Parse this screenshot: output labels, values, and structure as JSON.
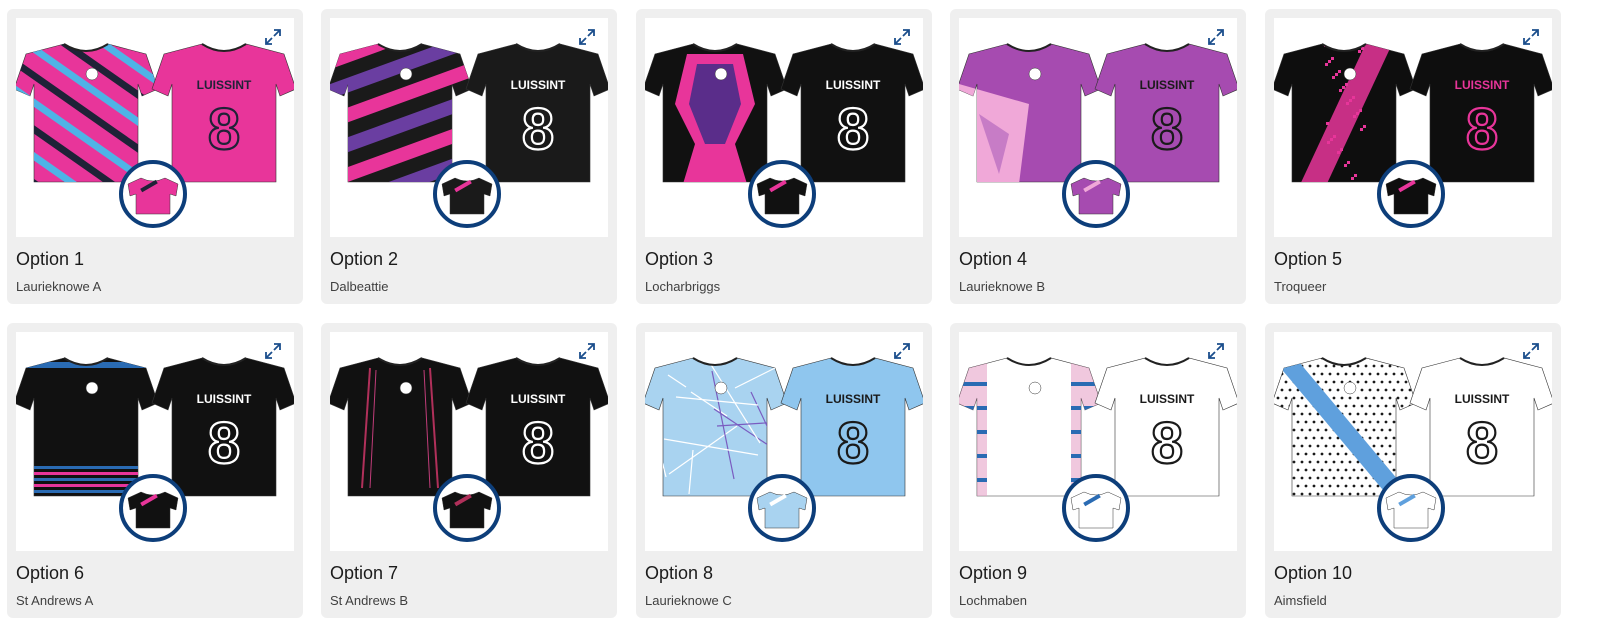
{
  "sponsor_text": "LUISSINT",
  "shirt_number": "8",
  "options": [
    {
      "title": "Option 1",
      "subtitle": "Laurieknowe A",
      "primary": "#e8359a",
      "secondary": "#1f2237",
      "accent": "#4fb3e6",
      "pattern": "stripes-diag",
      "back": "#e8359a",
      "num_color": "#1f2237",
      "thumb_ring": "#0d3e7a"
    },
    {
      "title": "Option 2",
      "subtitle": "Dalbeattie",
      "primary": "#1a1a1a",
      "secondary": "#e8359a",
      "accent": "#6a3ea1",
      "pattern": "bands-diag",
      "back": "#1a1a1a",
      "num_color": "#ffffff",
      "thumb_ring": "#0d3e7a"
    },
    {
      "title": "Option 3",
      "subtitle": "Locharbriggs",
      "primary": "#111111",
      "secondary": "#e8359a",
      "accent": "#5a2d8a",
      "pattern": "chevron",
      "back": "#111111",
      "num_color": "#ffffff",
      "thumb_ring": "#0d3e7a"
    },
    {
      "title": "Option 4",
      "subtitle": "Laurieknowe B",
      "primary": "#a64bb0",
      "secondary": "#f0a8d8",
      "accent": "#c77cc6",
      "pattern": "star",
      "back": "#a64bb0",
      "num_color": "#1a1a1a",
      "thumb_ring": "#0d3e7a"
    },
    {
      "title": "Option 5",
      "subtitle": "Troqueer",
      "primary": "#0e0e0e",
      "secondary": "#e8359a",
      "accent": "#e8359a",
      "pattern": "sash",
      "back": "#0e0e0e",
      "num_color": "#e8359a",
      "thumb_ring": "#0d3e7a"
    },
    {
      "title": "Option 6",
      "subtitle": "St Andrews A",
      "primary": "#111111",
      "secondary": "#e8359a",
      "accent": "#2a6bb3",
      "pattern": "hem-stripes",
      "back": "#111111",
      "num_color": "#ffffff",
      "thumb_ring": "#0d3e7a"
    },
    {
      "title": "Option 7",
      "subtitle": "St Andrews B",
      "primary": "#111111",
      "secondary": "#b0305a",
      "accent": "#c23d7a",
      "pattern": "pinstripe",
      "back": "#111111",
      "num_color": "#ffffff",
      "thumb_ring": "#0d3e7a"
    },
    {
      "title": "Option 8",
      "subtitle": "Laurieknowe C",
      "primary": "#a9d3f0",
      "secondary": "#ffffff",
      "accent": "#7a5cc0",
      "pattern": "geo",
      "back": "#8fc6ee",
      "num_color": "#1a1a1a",
      "thumb_ring": "#0d3e7a"
    },
    {
      "title": "Option 9",
      "subtitle": "Lochmaben",
      "primary": "#ffffff",
      "secondary": "#2a6bb3",
      "accent": "#e6a3c8",
      "pattern": "side-tartan",
      "back": "#ffffff",
      "num_color": "#1a1a1a",
      "thumb_ring": "#0d3e7a"
    },
    {
      "title": "Option 10",
      "subtitle": "Aimsfield",
      "primary": "#ffffff",
      "secondary": "#5fa0dd",
      "accent": "#b59a60",
      "pattern": "dots-sash",
      "back": "#ffffff",
      "num_color": "#1a1a1a",
      "thumb_ring": "#0d3e7a"
    }
  ]
}
